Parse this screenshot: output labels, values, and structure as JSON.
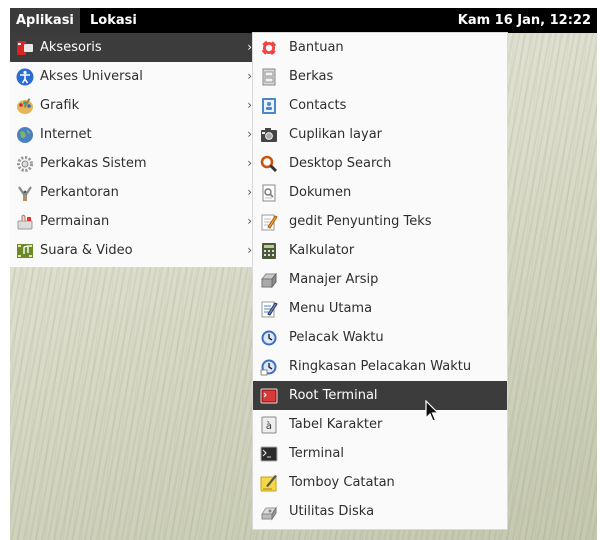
{
  "panel": {
    "menus": [
      "Aplikasi",
      "Lokasi"
    ],
    "clock": "Kam 16 Jan, 12:22"
  },
  "categories": [
    {
      "label": "Aksesoris",
      "icon": "accessories-icon",
      "highlighted": true
    },
    {
      "label": "Akses Universal",
      "icon": "universal-access-icon",
      "highlighted": false
    },
    {
      "label": "Grafik",
      "icon": "graphics-icon",
      "highlighted": false
    },
    {
      "label": "Internet",
      "icon": "internet-globe-icon",
      "highlighted": false
    },
    {
      "label": "Perkakas Sistem",
      "icon": "system-tools-icon",
      "highlighted": false
    },
    {
      "label": "Perkantoran",
      "icon": "office-icon",
      "highlighted": false
    },
    {
      "label": "Permainan",
      "icon": "games-icon",
      "highlighted": false
    },
    {
      "label": "Suara & Video",
      "icon": "sound-video-icon",
      "highlighted": false
    }
  ],
  "submenu_arrow": "›",
  "apps": [
    {
      "label": "Bantuan",
      "icon": "help-lifebuoy-icon"
    },
    {
      "label": "Berkas",
      "icon": "files-cabinet-icon"
    },
    {
      "label": "Contacts",
      "icon": "contacts-icon"
    },
    {
      "label": "Cuplikan layar",
      "icon": "screenshot-camera-icon"
    },
    {
      "label": "Desktop Search",
      "icon": "magnifier-icon"
    },
    {
      "label": "Dokumen",
      "icon": "document-viewer-icon"
    },
    {
      "label": "gedit Penyunting Teks",
      "icon": "text-editor-icon"
    },
    {
      "label": "Kalkulator",
      "icon": "calculator-icon"
    },
    {
      "label": "Manajer Arsip",
      "icon": "archive-manager-icon"
    },
    {
      "label": "Menu Utama",
      "icon": "main-menu-editor-icon"
    },
    {
      "label": "Pelacak Waktu",
      "icon": "time-tracker-icon"
    },
    {
      "label": "Ringkasan Pelacakan Waktu",
      "icon": "time-tracker-overview-icon"
    },
    {
      "label": "Root Terminal",
      "icon": "root-terminal-icon",
      "highlighted": true
    },
    {
      "label": "Tabel Karakter",
      "icon": "character-map-icon"
    },
    {
      "label": "Terminal",
      "icon": "terminal-icon"
    },
    {
      "label": "Tomboy Catatan",
      "icon": "tomboy-notes-icon"
    },
    {
      "label": "Utilitas Diska",
      "icon": "disk-utility-icon"
    }
  ],
  "colors": {
    "panel": "#000000",
    "highlight": "#3c3c3c",
    "menu_bg": "#fafafa"
  }
}
